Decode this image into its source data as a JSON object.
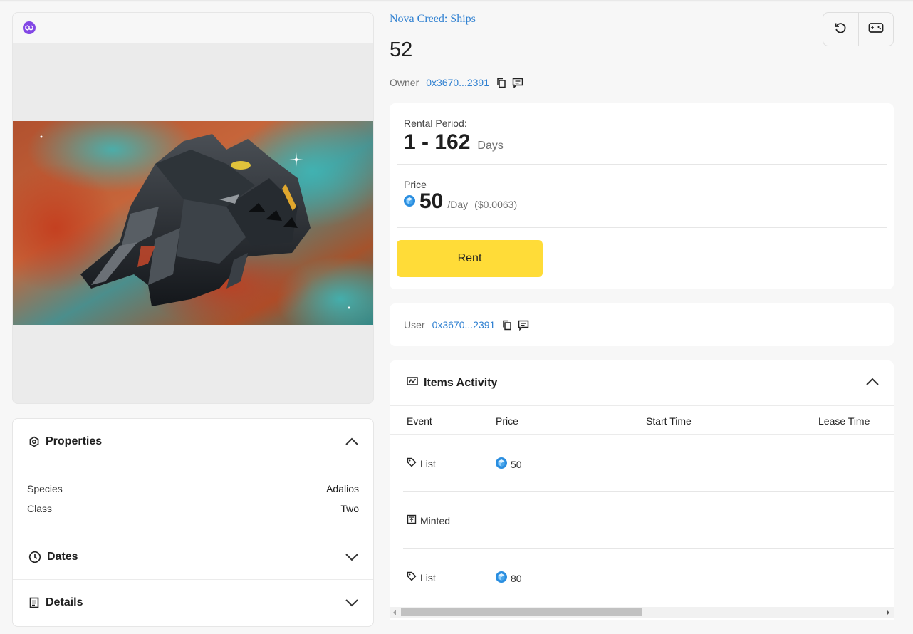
{
  "collection": {
    "name": "Nova Creed: Ships"
  },
  "token": {
    "name": "52"
  },
  "owner": {
    "label": "Owner",
    "address": "0x3670...2391"
  },
  "toolbar": {
    "refresh_icon": "refresh-icon",
    "game_icon": "gamepad-icon"
  },
  "rental": {
    "period_label": "Rental Period:",
    "period_value": "1 - 162",
    "period_unit": "Days",
    "price_label": "Price",
    "price_value": "50",
    "price_unit": "/Day",
    "price_usd": "($0.0063)",
    "rent_button": "Rent"
  },
  "user": {
    "label": "User",
    "address": "0x3670...2391"
  },
  "properties": {
    "title": "Properties",
    "items": [
      {
        "key": "Species",
        "value": "Adalios"
      },
      {
        "key": "Class",
        "value": "Two"
      }
    ]
  },
  "dates": {
    "title": "Dates"
  },
  "details": {
    "title": "Details"
  },
  "activity": {
    "title": "Items Activity",
    "columns": [
      "Event",
      "Price",
      "Start Time",
      "Lease Time"
    ],
    "rows": [
      {
        "event": "List",
        "price": "50",
        "start": "—",
        "lease": "—"
      },
      {
        "event": "Minted",
        "price": "—",
        "start": "—",
        "lease": "—"
      },
      {
        "event": "List",
        "price": "80",
        "start": "—",
        "lease": "—"
      }
    ]
  },
  "colors": {
    "accent": "#ffdc38",
    "link": "#2f80d1",
    "chain": "#8247e5"
  }
}
